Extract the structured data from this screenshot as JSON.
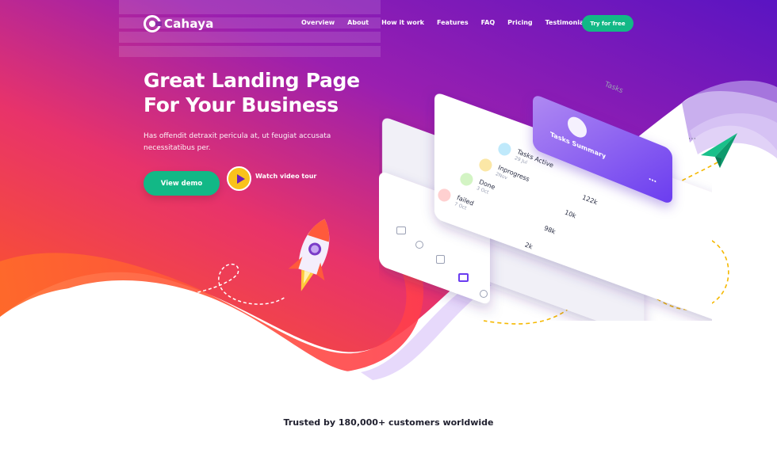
{
  "nav": {
    "logo_text": "Cahaya",
    "items": [
      {
        "label": "Overview"
      },
      {
        "label": "About"
      },
      {
        "label": "How it work"
      },
      {
        "label": "Features"
      },
      {
        "label": "FAQ"
      },
      {
        "label": "Pricing"
      },
      {
        "label": "Testimonials"
      }
    ],
    "cta_label": "Try for free"
  },
  "hero": {
    "headline_line1": "Great Landing Page",
    "headline_line2": "For Your Business",
    "subtext": "Has offendit detraxit pericula at, ut feugiat accusata necessitatibus per.",
    "primary_button": "View demo",
    "video_link": "Watch video tour"
  },
  "phone": {
    "screen_title": "Tasks",
    "card_title": "Tasks Summary",
    "tasks": [
      {
        "name": "Tasks Active",
        "date": "29 Jul",
        "value": "122k",
        "color": "#7fd3f5"
      },
      {
        "name": "Inprogress",
        "date": "2Nov",
        "value": "10k",
        "color": "#f9d86b"
      },
      {
        "name": "Done",
        "date": "3 Oct",
        "value": "98k",
        "color": "#9ce07c"
      },
      {
        "name": "failed",
        "date": "7 Oct",
        "value": "2k",
        "color": "#ff8a8a"
      }
    ]
  },
  "footer": {
    "trusted_text": "Trusted by 180,000+ customers worldwide"
  },
  "colors": {
    "accent_green": "#12b886",
    "play_yellow": "#f9c21b",
    "brand_purple": "#6b1fb6"
  }
}
